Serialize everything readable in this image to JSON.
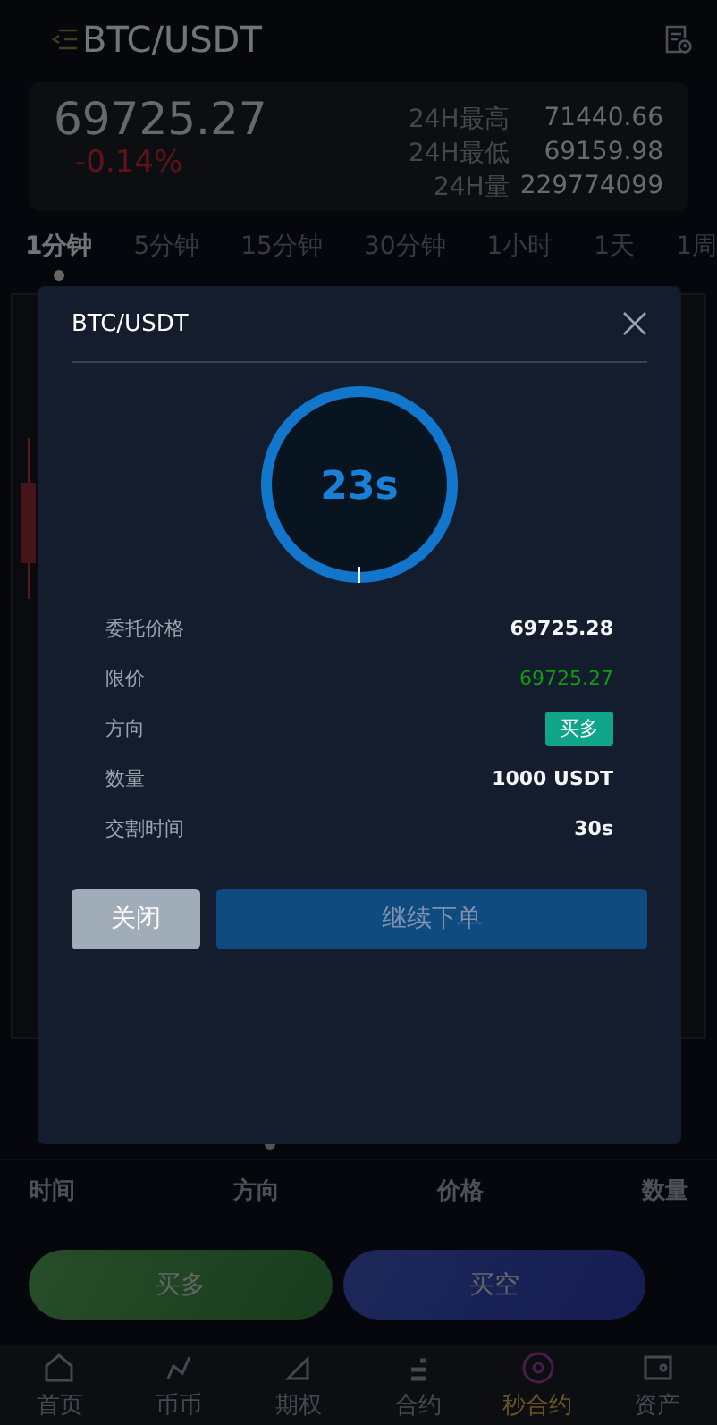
{
  "header": {
    "title": "BTC/USDT"
  },
  "ticker": {
    "price": "69725.27",
    "change": "-0.14%",
    "stats": [
      {
        "label": "24H最高",
        "value": "71440.66"
      },
      {
        "label": "24H最低",
        "value": "69159.98"
      },
      {
        "label": "24H量",
        "value": "229774099"
      }
    ]
  },
  "intervals": [
    {
      "label": "1分钟",
      "selected": true
    },
    {
      "label": "5分钟",
      "selected": false
    },
    {
      "label": "15分钟",
      "selected": false
    },
    {
      "label": "30分钟",
      "selected": false
    },
    {
      "label": "1小时",
      "selected": false
    },
    {
      "label": "1天",
      "selected": false
    },
    {
      "label": "1周",
      "selected": false
    }
  ],
  "trades_table": {
    "columns": [
      "时间",
      "方向",
      "价格",
      "数量"
    ]
  },
  "actions": [
    {
      "label": "买多",
      "kind": "long"
    },
    {
      "label": "买空",
      "kind": "short"
    }
  ],
  "nav": [
    {
      "label": "首页",
      "kind": "home",
      "selected": false
    },
    {
      "label": "币币",
      "kind": "graph",
      "selected": false
    },
    {
      "label": "期权",
      "kind": "triangle",
      "selected": false
    },
    {
      "label": "合约",
      "kind": "bars",
      "selected": false
    },
    {
      "label": "秒合约",
      "kind": "target",
      "selected": true
    },
    {
      "label": "资产",
      "kind": "wallet",
      "selected": false
    }
  ],
  "dialog": {
    "title": "BTC/USDT",
    "countdown": {
      "text": "23s",
      "level": 1
    },
    "rows": [
      {
        "label": "委托价格",
        "value": "69725.28",
        "kind": "text"
      },
      {
        "label": "限价",
        "value": "69725.27",
        "kind": "positive"
      },
      {
        "label": "方向",
        "value": "买多",
        "kind": "tag"
      },
      {
        "label": "数量",
        "value": "1000 USDT",
        "kind": "text"
      },
      {
        "label": "交割时间",
        "value": "30s",
        "kind": "text"
      }
    ],
    "buttons": [
      {
        "label": "关闭",
        "kind": "secondary"
      },
      {
        "label": "继续下单",
        "kind": "primary"
      }
    ]
  }
}
